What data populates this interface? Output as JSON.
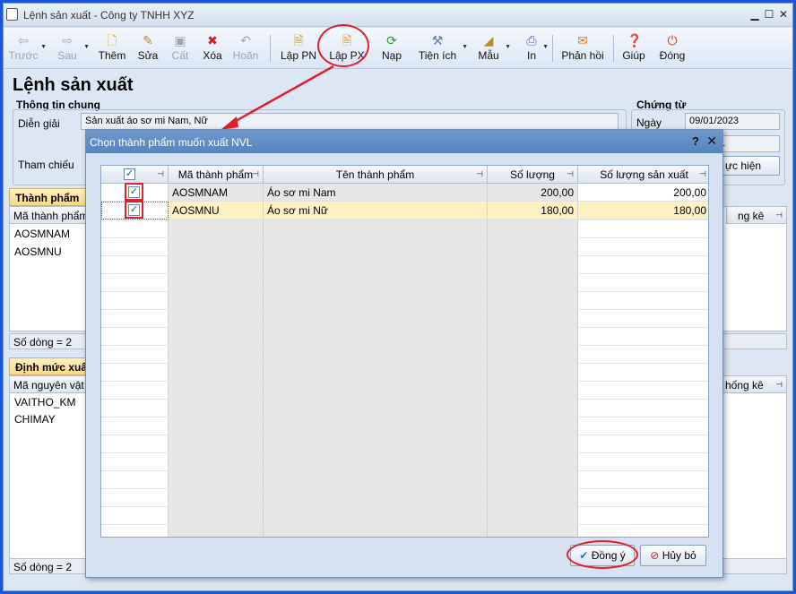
{
  "window": {
    "title": "Lệnh sản xuất - Công ty TNHH XYZ",
    "min": "▁",
    "max": "☐",
    "close": "✕"
  },
  "toolbar": {
    "prev": "Trước",
    "next": "Sau",
    "add": "Thêm",
    "edit": "Sửa",
    "save": "Cất",
    "delete": "Xóa",
    "undo": "Hoãn",
    "lap_pn": "Lập PN",
    "lap_px": "Lập PX",
    "reload": "Nạp",
    "utilities": "Tiện ích",
    "template": "Mẫu",
    "print": "In",
    "feedback": "Phản hồi",
    "help": "Giúp",
    "close": "Đóng"
  },
  "page": {
    "title": "Lệnh sản xuất"
  },
  "general": {
    "group_label": "Thông tin chung",
    "description_label": "Diễn giải",
    "description_value": "Sản xuất áo sơ mi Nam, Nữ",
    "reference_label": "Tham chiếu"
  },
  "voucher": {
    "group_label": "Chứng từ",
    "date_label": "Ngày",
    "date_value": "09/01/2023",
    "number_fragment": "01",
    "status_fragment": "ực hiện"
  },
  "products_panel": {
    "header": "Thành phẩm",
    "col_code": "Mã thành phẩm",
    "col_stat_fragment": "ng kê",
    "rows": [
      "AOSMNAM",
      "AOSMNU"
    ],
    "footer": "Số dòng = 2"
  },
  "materials_panel": {
    "header": "Định mức xuấ",
    "col_code": "Mã nguyên vật li",
    "col_stat_fragment": "hống kê",
    "rows": [
      "VAITHO_KM",
      "CHIMAY"
    ],
    "footer": "Số dòng = 2"
  },
  "dialog": {
    "title": "Chọn thành phẩm muốn xuất NVL",
    "help": "?",
    "close": "✕",
    "columns": {
      "check": "✓",
      "code": "Mã thành phẩm",
      "name": "Tên thành phẩm",
      "qty": "Số lượng",
      "prod_qty": "Số lượng sản xuất"
    },
    "rows": [
      {
        "checked": "✓",
        "code": "AOSMNAM",
        "name": "Áo sơ mi Nam",
        "qty": "200,00",
        "prod_qty": "200,00"
      },
      {
        "checked": "✓",
        "code": "AOSMNU",
        "name": "Áo sơ mi Nữ",
        "qty": "180,00",
        "prod_qty": "180,00"
      }
    ],
    "ok": "Đồng ý",
    "cancel": "Hủy bỏ"
  },
  "colors": {
    "accent_red": "#e0202a",
    "dialog_title": "#5a88c0",
    "selected_row": "#fdf1c4",
    "panel_header": "#f9d981"
  }
}
